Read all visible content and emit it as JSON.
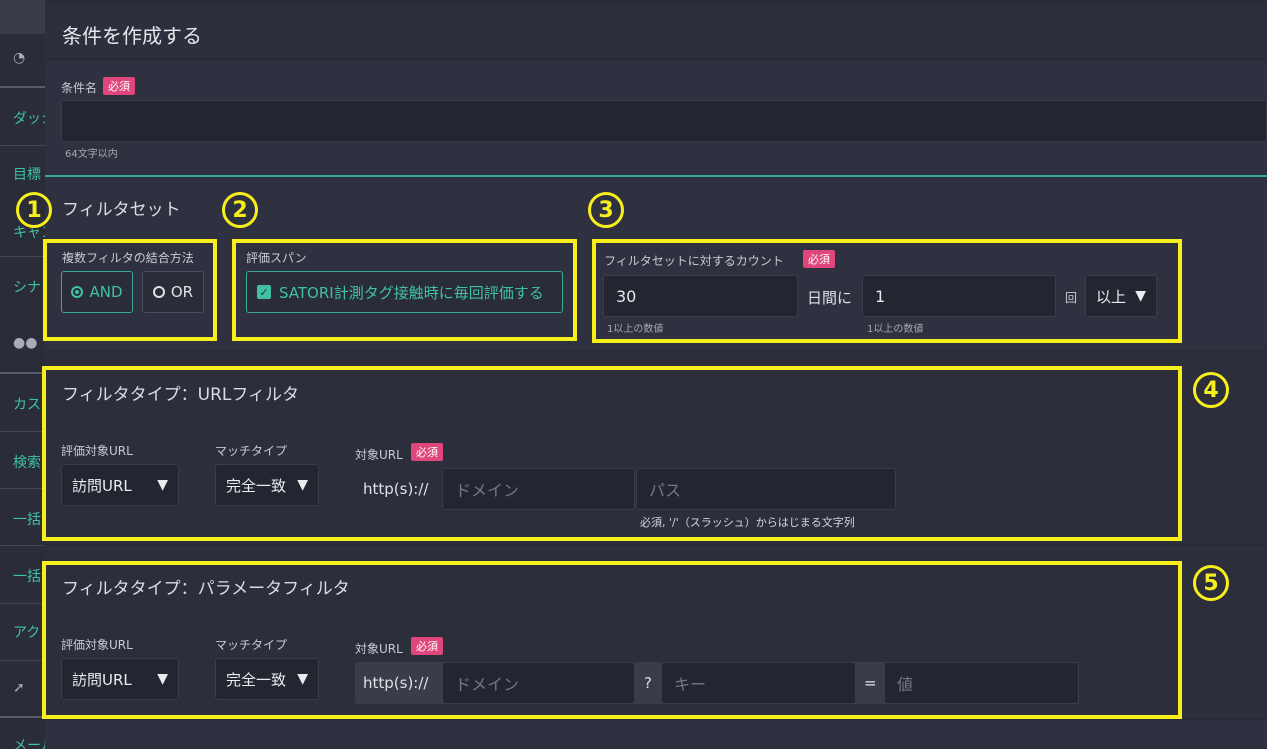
{
  "sidebar": {
    "items": [
      {
        "label": "ダッシュボード"
      },
      {
        "label": "目標"
      },
      {
        "label": "キャンペーン"
      },
      {
        "label": "シナリオ"
      },
      {
        "label": "カスタマー"
      },
      {
        "label": "検索"
      },
      {
        "label": "一括"
      },
      {
        "label": "一括"
      },
      {
        "label": "アクション"
      },
      {
        "label": "メール"
      }
    ]
  },
  "modal": {
    "title": "条件を作成する",
    "condition_name": {
      "label": "条件名",
      "required": "必須",
      "value": "",
      "hint": "64文字以内"
    },
    "filterset": {
      "title": "フィルタセット",
      "combine": {
        "label": "複数フィルタの結合方法",
        "options": [
          "AND",
          "OR"
        ],
        "selected": "AND"
      },
      "span": {
        "label": "評価スパン",
        "checkbox_label": "SATORI計測タグ接触時に毎回評価する",
        "checked": true
      },
      "count": {
        "label": "フィルタセットに対するカウント",
        "required": "必須",
        "days_value": "30",
        "days_unit": "日間に",
        "times_value": "1",
        "times_unit": "回",
        "comparison": "以上",
        "days_hint": "1以上の数値",
        "times_hint": "1以上の数値"
      }
    },
    "url_filter": {
      "title": "フィルタタイプ：URLフィルタ",
      "eval_label": "評価対象URL",
      "eval_value": "訪問URL",
      "match_label": "マッチタイプ",
      "match_value": "完全一致",
      "target_label": "対象URL",
      "required": "必須",
      "scheme": "http(s)://",
      "domain_placeholder": "ドメイン",
      "path_placeholder": "パス",
      "path_hint": "必須, '/'（スラッシュ）からはじまる文字列"
    },
    "param_filter": {
      "title": "フィルタタイプ：パラメータフィルタ",
      "eval_label": "評価対象URL",
      "eval_value": "訪問URL",
      "match_label": "マッチタイプ",
      "match_value": "完全一致",
      "target_label": "対象URL",
      "required": "必須",
      "scheme": "http(s)://",
      "domain_placeholder": "ドメイン",
      "question": "?",
      "key_placeholder": "キー",
      "equals": "=",
      "value_placeholder": "値"
    }
  },
  "annotations": {
    "markers": [
      "1",
      "2",
      "3",
      "4",
      "5"
    ],
    "color": "#f7ef1c"
  },
  "colors": {
    "accent": "#3fc1a5",
    "required_badge": "#e0457b",
    "modal_bg": "#2f3140"
  }
}
